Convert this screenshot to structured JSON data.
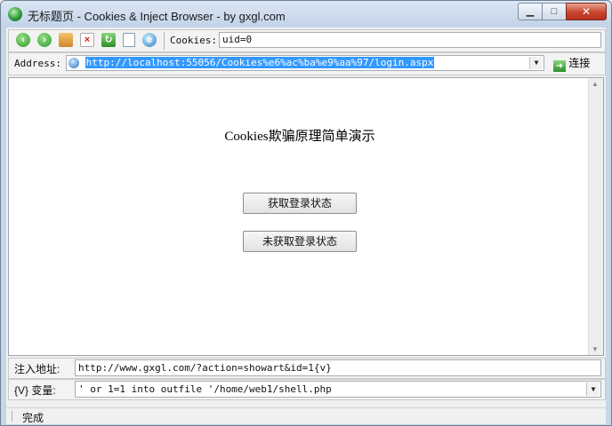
{
  "window": {
    "title": "无标题页 - Cookies & Inject Browser - by gxgl.com",
    "min_label": "▁",
    "max_label": "□",
    "close_label": "✕"
  },
  "toolbar": {
    "icons": [
      "back-icon",
      "forward-icon",
      "home-icon",
      "stop-icon",
      "refresh-icon",
      "new-page-icon",
      "ie-icon"
    ],
    "cookies_label": "Cookies:",
    "cookies_value": "uid=0"
  },
  "address": {
    "label": "Address:",
    "url": "http://localhost:55056/Cookies%e6%ac%ba%e9%aa%97/login.aspx",
    "connect_label": "连接"
  },
  "page": {
    "heading": "Cookies欺骗原理简单演示",
    "button1": "获取登录状态",
    "button2": "未获取登录状态"
  },
  "inject": {
    "address_label": "注入地址:",
    "address_value": "http://www.gxgl.com/?action=showart&id=1{v}",
    "var_label": "{V} 变量:",
    "var_value": "' or 1=1 into outfile '/home/web1/shell.php"
  },
  "status": {
    "text": "完成"
  },
  "colors": {
    "title_bg": "#c7d5e6",
    "close_red": "#c8452e",
    "url_highlight": "#3399ff"
  }
}
